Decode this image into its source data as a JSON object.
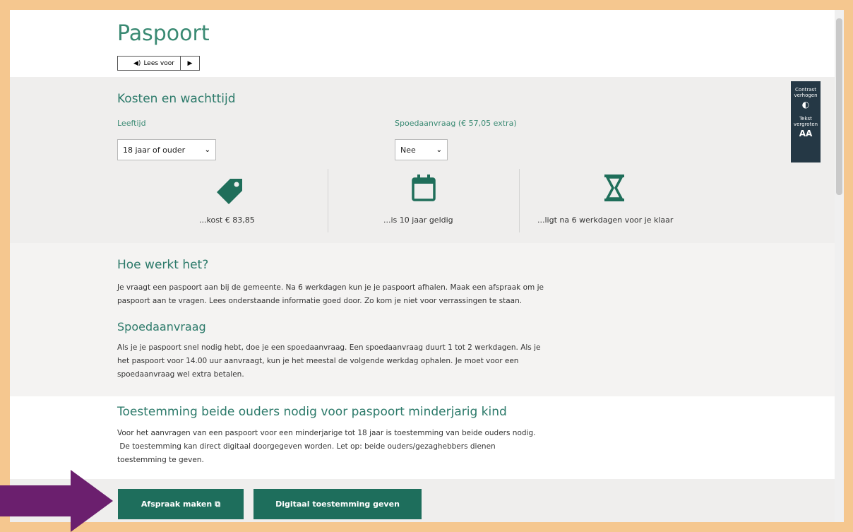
{
  "page": {
    "title": "Paspoort",
    "read_aloud_label": "Lees voor",
    "colors": {
      "accent": "#2c7a6a",
      "button": "#1e6e5c",
      "frame": "#f5c78f",
      "arrow": "#6b1f6e",
      "tool_bg": "#253845"
    }
  },
  "costs": {
    "heading": "Kosten en wachttijd",
    "age_label": "Leeftijd",
    "age_value": "18 jaar of ouder",
    "rush_label": "Spoedaanvraag (€ 57,05 extra)",
    "rush_value": "Nee",
    "facts": [
      {
        "icon": "tag-icon",
        "text": "...kost € 83,85"
      },
      {
        "icon": "calendar-icon",
        "text": "...is 10 jaar geldig"
      },
      {
        "icon": "hourglass-icon",
        "text": "...ligt na 6 werkdagen voor je klaar"
      }
    ]
  },
  "accessibility": {
    "contrast_label_1": "Contrast",
    "contrast_label_2": "verhogen",
    "text_label_1": "Tekst",
    "text_label_2": "vergroten",
    "text_icon": "AA"
  },
  "how": {
    "heading": "Hoe werkt het?",
    "line1": "Je vraagt een paspoort aan bij de gemeente. Na 6 werkdagen kun je je paspoort afhalen. Maak een afspraak om je",
    "line2": "paspoort aan te vragen. Lees onderstaande informatie goed door. Zo kom je niet voor verrassingen te staan."
  },
  "rush": {
    "heading": "Spoedaanvraag",
    "line1": "Als je je paspoort snel nodig hebt, doe je een spoedaanvraag. Een spoedaanvraag duurt 1 tot 2 werkdagen. Als je",
    "line2": "het paspoort voor 14.00 uur aanvraagt, kun je het meestal de volgende werkdag ophalen. Je moet voor een",
    "line3": "spoedaanvraag wel extra betalen."
  },
  "consent": {
    "heading": "Toestemming beide ouders nodig voor paspoort minderjarig kind",
    "line1": "Voor het aanvragen van een paspoort voor een minderjarige tot 18 jaar is toestemming van beide ouders nodig.",
    "line2": " De toestemming kan direct digitaal doorgegeven worden. Let op: beide ouders/gezaghebbers dienen",
    "line3": "toestemming te geven."
  },
  "buttons": {
    "appointment": "Afspraak maken",
    "digital_consent": "Digitaal toestemming geven"
  }
}
